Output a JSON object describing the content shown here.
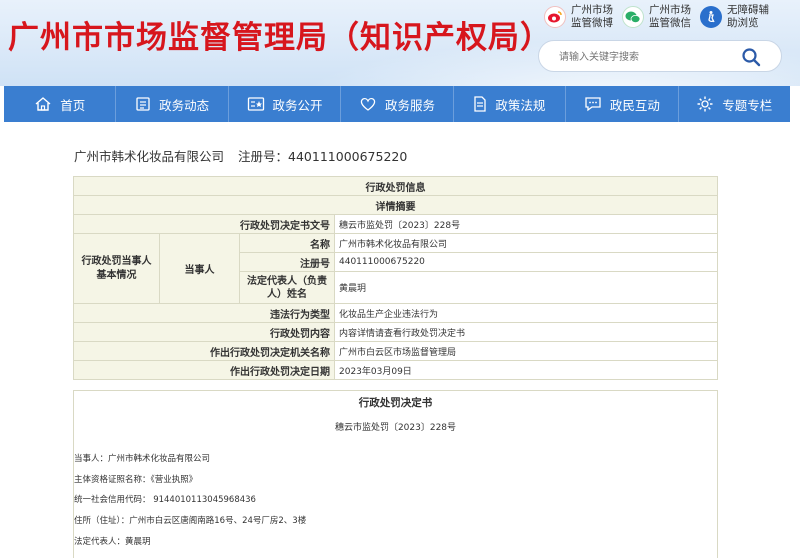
{
  "header": {
    "site_title": "广州市市场监督管理局（知识产权局）",
    "links": [
      {
        "label": "广州市场监管微博",
        "icon": "weibo-icon",
        "color": "#e6162d"
      },
      {
        "label": "广州市场监管微信",
        "icon": "wechat-icon",
        "color": "#2aae67"
      },
      {
        "label": "无障碍辅助浏览",
        "icon": "accessibility-icon",
        "color": "#2a6fcc"
      }
    ],
    "search": {
      "placeholder": "请输入关键字搜索"
    }
  },
  "nav": {
    "items": [
      {
        "label": "首页",
        "icon": "home-icon"
      },
      {
        "label": "政务动态",
        "icon": "news-icon"
      },
      {
        "label": "政务公开",
        "icon": "open-icon"
      },
      {
        "label": "政务服务",
        "icon": "service-icon"
      },
      {
        "label": "政策法规",
        "icon": "document-icon"
      },
      {
        "label": "政民互动",
        "icon": "chat-icon"
      },
      {
        "label": "专题专栏",
        "icon": "topic-icon"
      }
    ]
  },
  "company": {
    "name": "广州市韩术化妆品有限公司",
    "reg_label": "注册号：",
    "reg_no": "440111000675220"
  },
  "table": {
    "title": "行政处罚信息",
    "subtitle": "详情摘要",
    "decision_no_label": "行政处罚决定书文号",
    "decision_no": "穗云市监处罚〔2023〕228号",
    "party_group_label": "行政处罚当事人基本情况",
    "party_label": "当事人",
    "name_label": "名称",
    "name": "广州市韩术化妆品有限公司",
    "reg_label": "注册号",
    "reg": "440111000675220",
    "rep_label": "法定代表人（负责人）姓名",
    "rep": "黄晨玥",
    "type_label": "违法行为类型",
    "type": "化妆品生产企业违法行为",
    "content_label": "行政处罚内容",
    "content": "内容详情请查看行政处罚决定书",
    "authority_label": "作出行政处罚决定机关名称",
    "authority": "广州市白云区市场监督管理局",
    "date_label": "作出行政处罚决定日期",
    "date": "2023年03月09日"
  },
  "doc": {
    "title": "行政处罚决定书",
    "number": "穗云市监处罚〔2023〕228号",
    "lines": [
      "当事人：广州市韩术化妆品有限公司",
      "主体资格证照名称：《营业执照》",
      "统一社会信用代码： 91440101130459684​36",
      "住所（住址）：广州市白云区唐阁南路16号、24号厂房2、3楼",
      "法定代表人：黄晨玥"
    ]
  }
}
